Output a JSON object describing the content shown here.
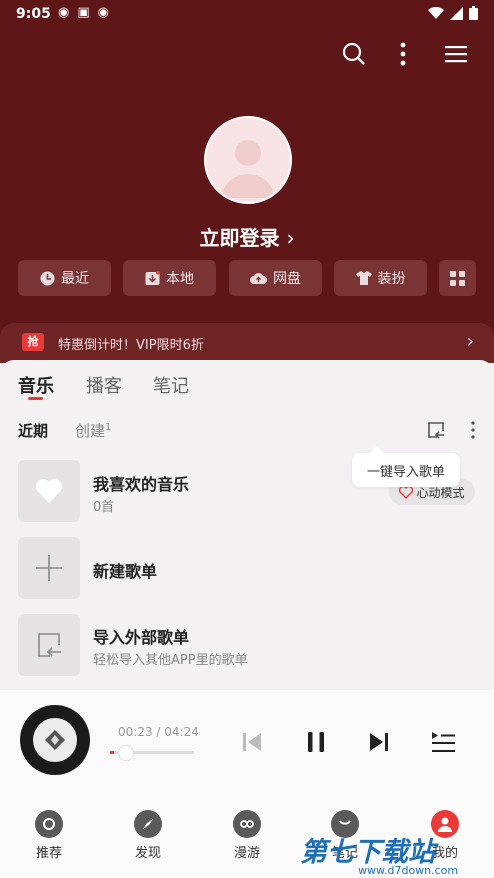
{
  "status": {
    "time": "9:05",
    "battery": "▮"
  },
  "header": {
    "login_label": "立即登录",
    "chevron": "›",
    "quick": [
      {
        "label": "最近",
        "icon": "clock-icon"
      },
      {
        "label": "本地",
        "icon": "local-download-icon"
      },
      {
        "label": "网盘",
        "icon": "cloud-icon"
      },
      {
        "label": "装扮",
        "icon": "shirt-icon"
      }
    ]
  },
  "promo": {
    "badge": "抢",
    "text": "特惠倒计时！VIP限时6折"
  },
  "tabs": [
    "音乐",
    "播客",
    "笔记"
  ],
  "subtabs": {
    "recent": "近期",
    "created": "创建",
    "created_count": "1"
  },
  "tooltip": "一键导入歌单",
  "heart_mode": "心动模式",
  "playlists": [
    {
      "title": "我喜欢的音乐",
      "subtitle": "0首"
    },
    {
      "title": "新建歌单",
      "subtitle": ""
    },
    {
      "title": "导入外部歌单",
      "subtitle": "轻松导入其他APP里的歌单"
    }
  ],
  "player": {
    "time": "00:23 / 04:24",
    "progress": 0.05
  },
  "nav": [
    "推荐",
    "发现",
    "漫游",
    "笔记",
    "我的"
  ],
  "watermark": {
    "title": "第七下载站",
    "url": "www.d7down.com"
  },
  "colors": {
    "header_bg": "#5e1618",
    "accent": "#e93a3a"
  }
}
